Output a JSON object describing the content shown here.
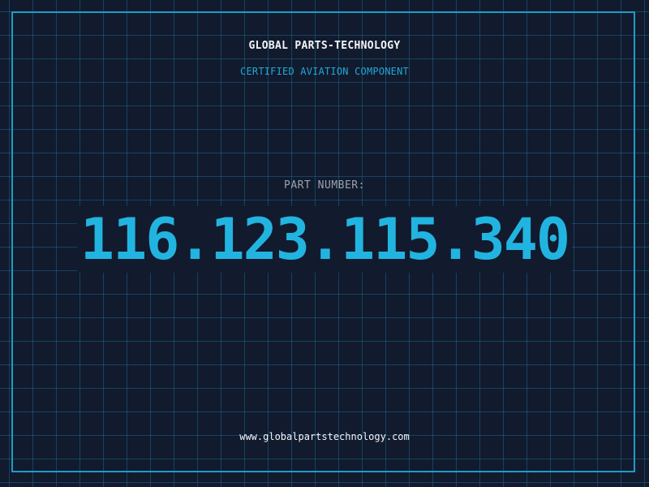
{
  "header": {
    "brand": "GLOBAL PARTS-TECHNOLOGY",
    "subtitle": "CERTIFIED AVIATION COMPONENT"
  },
  "part": {
    "label": "PART NUMBER:",
    "number": "116.123.115.340"
  },
  "footer": {
    "website": "www.globalpartstechnology.com"
  },
  "colors": {
    "background": "#121a2e",
    "grid": "#1a9bc8",
    "frame": "#1c9ec6",
    "accent": "#22b4e0",
    "text_primary": "#f2f5f8",
    "text_muted": "#9aa3ad"
  }
}
